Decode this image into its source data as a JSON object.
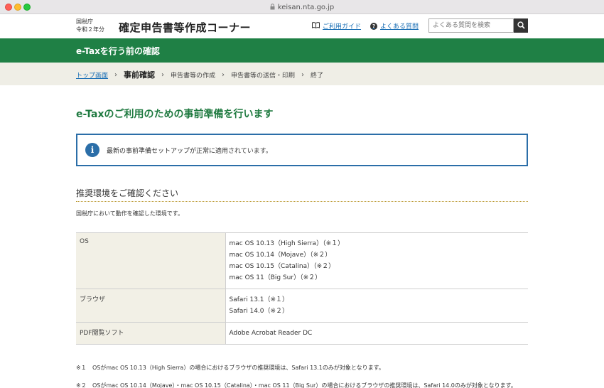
{
  "browser": {
    "url": "keisan.nta.go.jp"
  },
  "header": {
    "agency_line1": "国税庁",
    "agency_line2": "令和２年分",
    "site_title": "確定申告書等作成コーナー",
    "guide_link": "ご利用ガイド",
    "faq_link": "よくある質問",
    "search_placeholder": "よくある質問を検索"
  },
  "green_banner": {
    "title": "e-Taxを行う前の確認"
  },
  "breadcrumb": {
    "items": [
      "トップ画面",
      "事前確認",
      "申告書等の作成",
      "申告書等の送信・印刷",
      "終了"
    ]
  },
  "main": {
    "heading": "e-Taxのご利用のための事前準備を行います",
    "notice": "最新の事前準備セットアップが正常に適用されています。",
    "section_title": "推奨環境をご確認ください",
    "intro": "国税庁において動作を確認した環境です。",
    "env_table": [
      {
        "key": "OS",
        "values": [
          "mac OS 10.13（High Sierra）（※１）",
          "mac OS 10.14（Mojave）（※２）",
          "mac OS 10.15（Catalina）（※２）",
          "mac OS 11（Big Sur）（※２）"
        ]
      },
      {
        "key": "ブラウザ",
        "values": [
          "Safari 13.1（※１）",
          "Safari 14.0（※２）"
        ]
      },
      {
        "key": "PDF閲覧ソフト",
        "values": [
          "Adobe Acrobat Reader DC"
        ]
      }
    ],
    "notes": [
      {
        "mark": "※１",
        "text": "OSがmac OS 10.13（High Sierra）の場合におけるブラウザの推奨環境は、Safari 13.1のみが対象となります。"
      },
      {
        "mark": "※２",
        "text": "OSがmac OS 10.14（Mojave）・mac OS 10.15（Catalina）・mac OS 11（Big Sur）の場合におけるブラウザの推奨環境は、Safari 14.0のみが対象となります。"
      }
    ]
  },
  "colors": {
    "brand_green": "#1f8045",
    "heading_green": "#1f7a40",
    "notice_blue": "#2b6ea8",
    "link_blue": "#1a6fb5"
  }
}
